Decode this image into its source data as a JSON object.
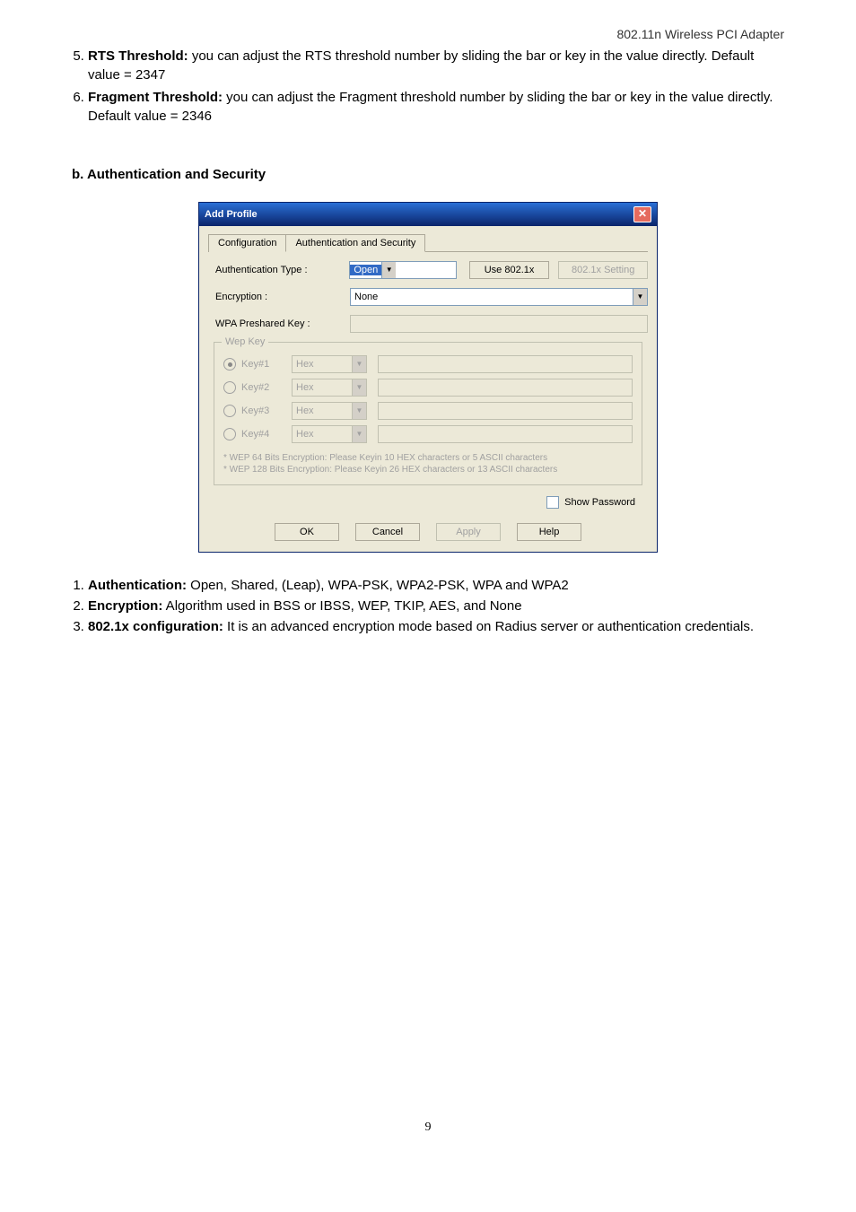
{
  "header_right": "802.11n Wireless PCI Adapter",
  "intro_list": {
    "start": 5,
    "items": [
      {
        "bold": "RTS Threshold:",
        "text": " you can adjust the RTS threshold number by sliding the bar or key in the value directly. Default value = 2347"
      },
      {
        "bold": "Fragment Threshold:",
        "text": " you can adjust the Fragment threshold number by sliding the bar or key in the value directly. Default value = 2346"
      }
    ]
  },
  "section_b_title": "b. Authentication and Security",
  "dialog": {
    "title": "Add Profile",
    "tabs": [
      "Configuration",
      "Authentication and Security"
    ],
    "active_tab": 1,
    "auth_label": "Authentication Type :",
    "auth_value": "Open",
    "use8021x_label": "Use 802.1x",
    "setting8021x_label": "802.1x Setting",
    "enc_label": "Encryption :",
    "enc_value": "None",
    "wpa_label": "WPA Preshared Key :",
    "wep": {
      "legend": "Wep Key",
      "rows": [
        {
          "label": "Key#1",
          "type": "Hex",
          "selected": true
        },
        {
          "label": "Key#2",
          "type": "Hex",
          "selected": false
        },
        {
          "label": "Key#3",
          "type": "Hex",
          "selected": false
        },
        {
          "label": "Key#4",
          "type": "Hex",
          "selected": false
        }
      ],
      "help1": "* WEP 64 Bits Encryption:  Please Keyin 10 HEX characters or 5 ASCII characters",
      "help2": "* WEP 128 Bits Encryption:  Please Keyin 26 HEX characters or 13 ASCII characters"
    },
    "show_pw": "Show Password",
    "buttons": {
      "ok": "OK",
      "cancel": "Cancel",
      "apply": "Apply",
      "help": "Help"
    }
  },
  "bottom_list": {
    "items": [
      {
        "bold": "Authentication:",
        "text": " Open, Shared, (Leap), WPA-PSK, WPA2-PSK, WPA and WPA2"
      },
      {
        "bold": "Encryption:",
        "text": " Algorithm used in BSS or IBSS, WEP, TKIP, AES, and None"
      },
      {
        "bold": "802.1x configuration:",
        "text": " It is an advanced encryption mode based on Radius server or authentication credentials."
      }
    ]
  },
  "page_number": "9"
}
